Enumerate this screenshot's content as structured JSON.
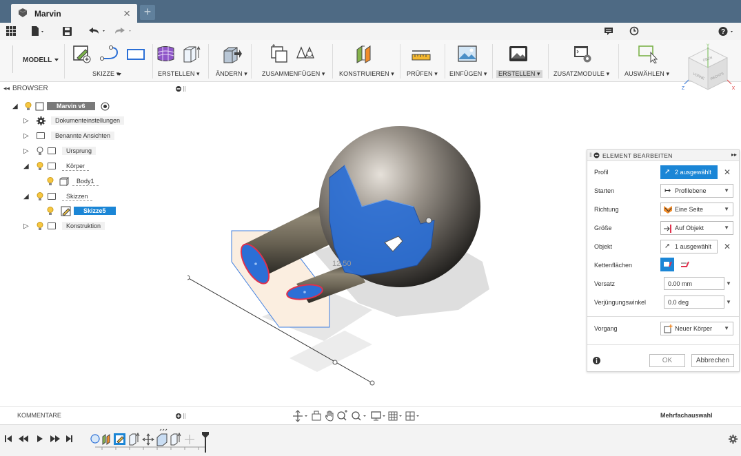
{
  "window": {
    "tab_title": "Marvin",
    "tab_close": "×",
    "tab_add": "+"
  },
  "ribbon": {
    "workspace": "MODELL",
    "groups": [
      {
        "label": "SKIZZE"
      },
      {
        "label": "ERSTELLEN"
      },
      {
        "label": "ÄNDERN"
      },
      {
        "label": "ZUSAMMENFÜGEN"
      },
      {
        "label": "KONSTRUIEREN"
      },
      {
        "label": "PRÜFEN"
      },
      {
        "label": "EINFÜGEN"
      },
      {
        "label": "ERSTELLEN"
      },
      {
        "label": "ZUSATZMODULE"
      },
      {
        "label": "AUSWÄHLEN"
      }
    ]
  },
  "browser": {
    "title": "BROWSER",
    "root": "Marvin v6",
    "items": [
      {
        "label": "Dokumenteinstellungen"
      },
      {
        "label": "Benannte Ansichten"
      },
      {
        "label": "Ursprung"
      },
      {
        "label": "Körper"
      },
      {
        "label": "Body1"
      },
      {
        "label": "Skizzen"
      },
      {
        "label": "Skizze5"
      },
      {
        "label": "Konstruktion"
      }
    ]
  },
  "viewport": {
    "dimension_text": "12.50"
  },
  "viewcube": {
    "top": "OBEN",
    "front": "VORNE",
    "right": "RECHTS",
    "axis_x": "X",
    "axis_y": "Y",
    "axis_z": "Z"
  },
  "panel": {
    "title": "ELEMENT BEARBEITEN",
    "rows": {
      "profil": {
        "label": "Profil",
        "value": "2 ausgewählt"
      },
      "starten": {
        "label": "Starten",
        "value": "Profilebene"
      },
      "richtung": {
        "label": "Richtung",
        "value": "Eine Seite"
      },
      "groesse": {
        "label": "Größe",
        "value": "Auf Objekt"
      },
      "objekt": {
        "label": "Objekt",
        "value": "1 ausgewählt"
      },
      "kettenflaechen": {
        "label": "Kettenflächen"
      },
      "versatz": {
        "label": "Versatz",
        "value": "0.00 mm"
      },
      "verjuengung": {
        "label": "Verjüngungswinkel",
        "value": "0.0 deg"
      },
      "vorgang": {
        "label": "Vorgang",
        "value": "Neuer Körper"
      }
    },
    "ok": "OK",
    "cancel": "Abbrechen"
  },
  "statusbar": {
    "comments": "KOMMENTARE",
    "selection_mode": "Mehrfachauswahl"
  },
  "colors": {
    "titlebar": "#4e6a84",
    "selection_blue": "#1b86d6",
    "highlight_blue": "#2b6fd6"
  }
}
